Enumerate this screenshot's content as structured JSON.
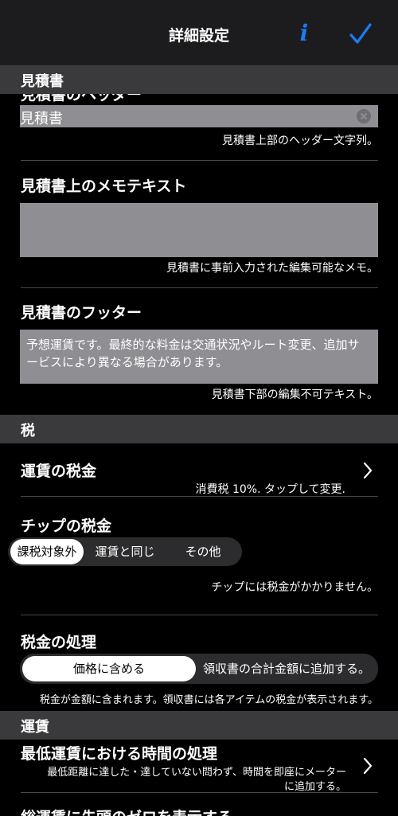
{
  "nav": {
    "title": "詳細設定",
    "info_icon": "info-icon",
    "confirm_icon": "checkmark-icon",
    "accent": "#1a7cf5"
  },
  "sections": {
    "estimate": "見積書",
    "tax": "税",
    "fare": "運賃"
  },
  "estimate": {
    "header_title": "見積書のヘッダー",
    "header_value": "見積書",
    "header_caption": "見積書上部のヘッダー文字列。",
    "memo_title": "見積書上のメモテキスト",
    "memo_value": "",
    "memo_caption": "見積書に事前入力された編集可能なメモ。",
    "footer_title": "見積書のフッター",
    "footer_value": "予想運賃です。最終的な料金は交通状況やルート変更、追加サービスにより異なる場合があります。",
    "footer_caption": "見積書下部の編集不可テキスト。"
  },
  "tax": {
    "fare_tax_title": "運賃の税金",
    "fare_tax_caption": "消費税 10%. タップして変更.",
    "tip_tax_title": "チップの税金",
    "tip_tax_options": [
      "課税対象外",
      "運賃と同じ",
      "その他"
    ],
    "tip_tax_selected": "課税対象外",
    "tip_tax_caption": "チップには税金がかかりません。",
    "handling_title": "税金の処理",
    "handling_options": [
      "価格に含める",
      "領収書の合計金額に追加する。"
    ],
    "handling_selected": "価格に含める",
    "handling_caption": "税金が金額に含まれます。領収書には各アイテムの税金が表示されます。"
  },
  "fare": {
    "min_fare_title": "最低運賃における時間の処理",
    "min_fare_caption_1": "最低距離に達した・達していない問わず、時間を即座にメーター",
    "min_fare_caption_2": "に追加する。",
    "leading_zero_title": "総運賃に先頭のゼロを表示する"
  }
}
